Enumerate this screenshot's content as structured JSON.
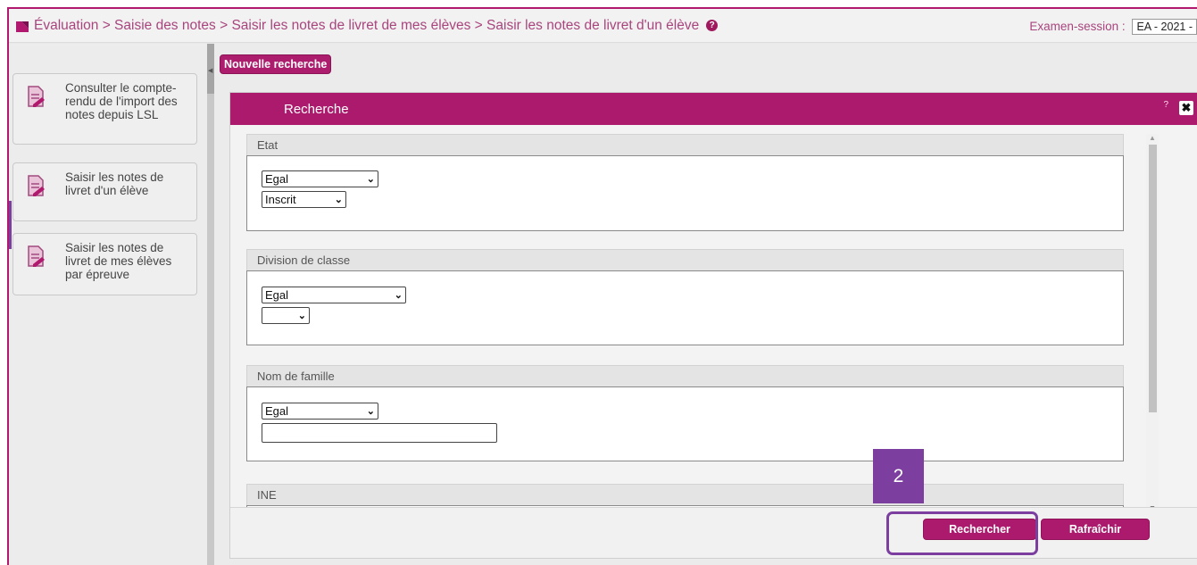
{
  "breadcrumb": {
    "text": "Évaluation > Saisie des notes > Saisir les notes de livret de mes élèves > Saisir les notes de livret d'un élève",
    "help_icon": "?"
  },
  "session": {
    "label": "Examen-session :",
    "value": "EA - 2021 -"
  },
  "sidebar": {
    "items": [
      {
        "label": "Consulter le compte-rendu de l'import des notes depuis LSL",
        "icon": "document-edit-icon"
      },
      {
        "label": "Saisir les notes de livret d'un élève",
        "icon": "document-edit-icon"
      },
      {
        "label": "Saisir les notes de livret de mes élèves par épreuve",
        "icon": "document-edit-icon"
      }
    ]
  },
  "main": {
    "new_search_label": "Nouvelle recherche",
    "panel": {
      "title": "Recherche",
      "help_icon": "?",
      "close_icon": "✖",
      "sections": [
        {
          "title": "Etat",
          "operator": "Egal",
          "value": "Inscrit"
        },
        {
          "title": "Division de classe",
          "operator": "Egal",
          "value": ""
        },
        {
          "title": "Nom de famille",
          "operator": "Egal",
          "input_value": ""
        },
        {
          "title": "INE"
        }
      ],
      "search_button": "Rechercher",
      "refresh_button": "Rafraîchir"
    }
  },
  "annotation": {
    "step": "2"
  },
  "colors": {
    "accent": "#ab1a6c",
    "annotation": "#7c3fa0",
    "breadcrumb_text": "#a8457d"
  }
}
